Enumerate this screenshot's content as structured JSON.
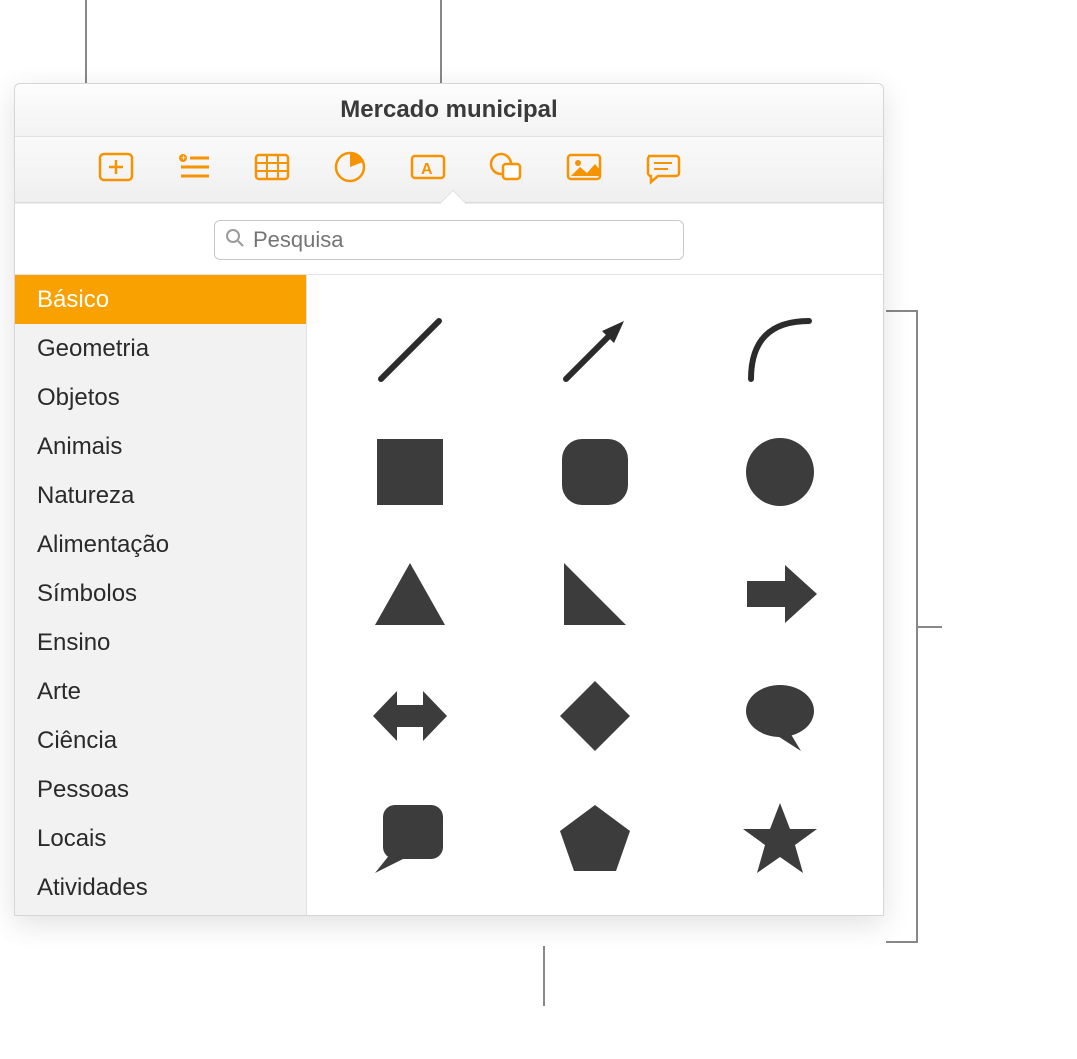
{
  "colors": {
    "accent": "#f9a100",
    "shape": "#3c3c3c",
    "toolbar_icon": "#f59300"
  },
  "window": {
    "title": "Mercado municipal"
  },
  "toolbar": {
    "items": [
      {
        "name": "insert-button",
        "icon": "insert-icon"
      },
      {
        "name": "list-button",
        "icon": "list-icon"
      },
      {
        "name": "table-button",
        "icon": "table-icon"
      },
      {
        "name": "chart-button",
        "icon": "chart-icon"
      },
      {
        "name": "textbox-button",
        "icon": "textbox-icon"
      },
      {
        "name": "shape-button",
        "icon": "shape-icon"
      },
      {
        "name": "media-button",
        "icon": "media-icon"
      },
      {
        "name": "comment-button",
        "icon": "comment-icon"
      }
    ]
  },
  "search": {
    "placeholder": "Pesquisa",
    "value": ""
  },
  "sidebar": {
    "items": [
      {
        "label": "Básico",
        "selected": true
      },
      {
        "label": "Geometria",
        "selected": false
      },
      {
        "label": "Objetos",
        "selected": false
      },
      {
        "label": "Animais",
        "selected": false
      },
      {
        "label": "Natureza",
        "selected": false
      },
      {
        "label": "Alimentação",
        "selected": false
      },
      {
        "label": "Símbolos",
        "selected": false
      },
      {
        "label": "Ensino",
        "selected": false
      },
      {
        "label": "Arte",
        "selected": false
      },
      {
        "label": "Ciência",
        "selected": false
      },
      {
        "label": "Pessoas",
        "selected": false
      },
      {
        "label": "Locais",
        "selected": false
      },
      {
        "label": "Atividades",
        "selected": false
      }
    ]
  },
  "shapes": {
    "items": [
      {
        "name": "line-shape"
      },
      {
        "name": "arrow-line-shape"
      },
      {
        "name": "curve-shape"
      },
      {
        "name": "square-shape"
      },
      {
        "name": "rounded-square-shape"
      },
      {
        "name": "circle-shape"
      },
      {
        "name": "triangle-shape"
      },
      {
        "name": "right-triangle-shape"
      },
      {
        "name": "arrow-right-shape"
      },
      {
        "name": "arrow-double-shape"
      },
      {
        "name": "diamond-shape"
      },
      {
        "name": "speech-bubble-shape"
      },
      {
        "name": "callout-square-shape"
      },
      {
        "name": "pentagon-shape"
      },
      {
        "name": "star-shape"
      }
    ]
  }
}
